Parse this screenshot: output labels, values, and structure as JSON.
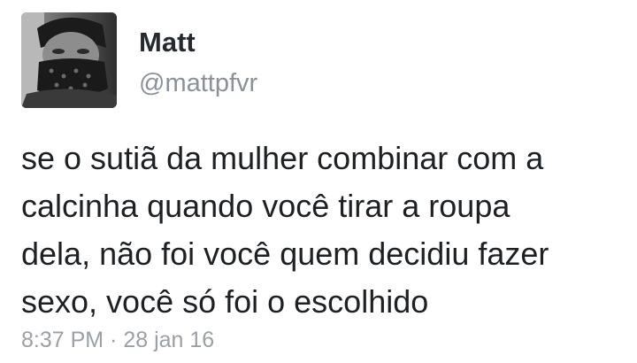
{
  "user": {
    "name": "Matt",
    "handle": "@mattpfvr",
    "avatar_icon": "profile-photo-masked-person"
  },
  "tweet": {
    "text": "se o sutiã da mulher combinar com a\ncalcinha quando você tirar a roupa\ndela, não foi você quem decidiu fazer\nsexo, você só foi o escolhido",
    "timestamp": "8:37 PM · 28 jan 16"
  },
  "colors": {
    "name": "#262a2e",
    "handle": "#8a9198",
    "text": "#1d2124",
    "timestamp": "#9aa0a6"
  }
}
